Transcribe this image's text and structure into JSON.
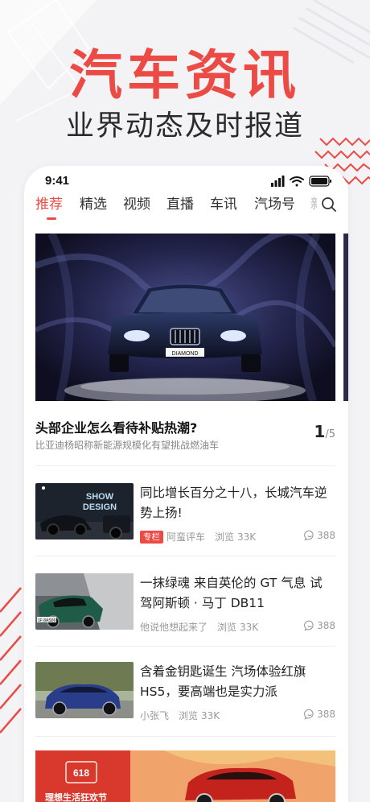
{
  "promo": {
    "title": "汽车资讯",
    "subtitle": "业界动态及时报道"
  },
  "colors": {
    "accent": "#ec4b45",
    "text": "#222222",
    "muted": "#999999"
  },
  "status_bar": {
    "time": "9:41"
  },
  "tabs": [
    {
      "label": "推荐",
      "active": true
    },
    {
      "label": "精选",
      "active": false
    },
    {
      "label": "视频",
      "active": false
    },
    {
      "label": "直播",
      "active": false
    },
    {
      "label": "车讯",
      "active": false
    },
    {
      "label": "汽场号",
      "active": false
    }
  ],
  "hero": {
    "title": "头部企业怎么看待补贴热潮?",
    "subtitle": "比亚迪杨昭称新能源规模化有望挑战燃油车",
    "page_current": "1",
    "page_total": "/5",
    "plate_text": "DIAMOND"
  },
  "news": [
    {
      "title": "同比增长百分之十八，长城汽车逆势上扬!",
      "tag": "专栏",
      "author": "阿蛮评车",
      "views_label": "浏览",
      "views": "33K",
      "comments": "388",
      "thumb_text": "SHOW DESIGN"
    },
    {
      "title": "一抹绿魂 来自英伦的 GT 气息 试驾阿斯顿 · 马丁 DB11",
      "tag": "",
      "author": "他说他想起来了",
      "views_label": "浏览",
      "views": "33K",
      "comments": "388",
      "thumb_text": "1F·8AS06"
    },
    {
      "title": "含着金钥匙诞生 汽场体验红旗 HS5，要高端也是实力派",
      "tag": "",
      "author": "小张飞",
      "views_label": "浏览",
      "views": "33K",
      "comments": "388",
      "thumb_text": ""
    }
  ],
  "ad": {
    "text": "理想生活狂欢节",
    "badge": "618"
  }
}
